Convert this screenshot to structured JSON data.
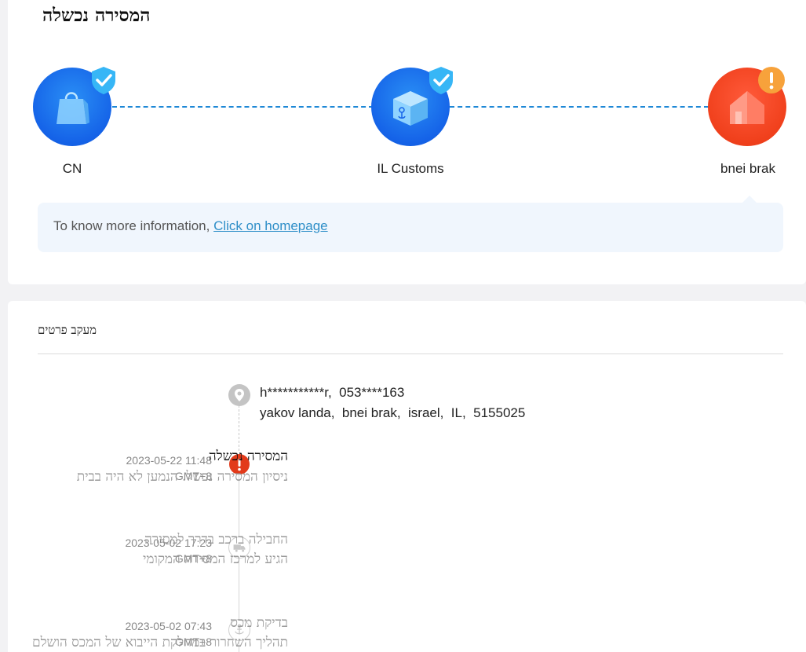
{
  "header": {
    "status_title": "המסירה נכשלה"
  },
  "route": {
    "nodes": [
      {
        "label": "CN",
        "icon": "shopping-bag-icon",
        "badge": "check-shield-icon"
      },
      {
        "label": "IL Customs",
        "icon": "package-box-icon",
        "badge": "check-shield-icon"
      },
      {
        "label": "bnei brak",
        "icon": "house-icon",
        "badge": "warning-icon"
      }
    ]
  },
  "info": {
    "text": "To know more information, ",
    "link": "Click on homepage"
  },
  "details": {
    "title": "מעקב פרטים",
    "address": {
      "line1": "h***********r,  053****163",
      "line2": "yakov landa,  bnei brak,  israel,  IL,  5155025"
    },
    "events": [
      {
        "time": "2023-05-22 11:48",
        "tz": "GMT+8",
        "title": "המסירה נכשלה",
        "desc": "ניסיון המסירה נכשל. הנמען לא היה בבית",
        "icon": "alert-icon"
      },
      {
        "time": "2023-05-02 17:23",
        "tz": "GMT+8",
        "title": "החבילה ברכב בדרך למסירה",
        "desc": "הגיע למרכז המסירה המקומי",
        "icon": "truck-icon"
      },
      {
        "time": "2023-05-02 07:43",
        "tz": "GMT+8",
        "title": "בדיקת מכס",
        "desc": "תהליך השחרור במחלקת הייבוא של המכס הושלם",
        "icon": "anchor-icon"
      }
    ]
  },
  "colors": {
    "accent_blue": "#1563e8",
    "alert_red": "#e23a1a",
    "link": "#2f8fc8"
  }
}
